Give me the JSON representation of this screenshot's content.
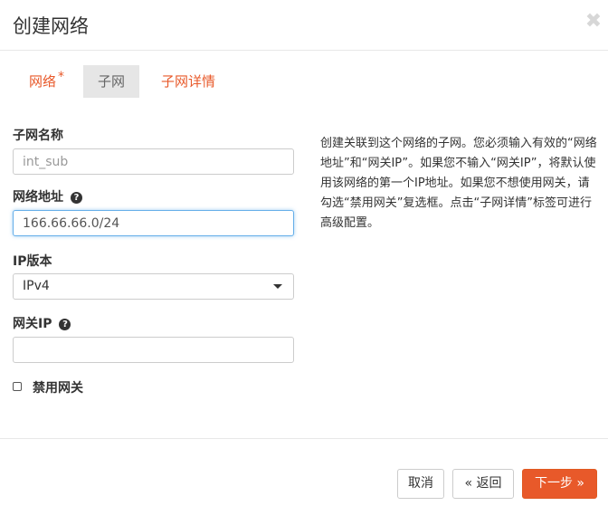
{
  "modal": {
    "title": "创建网络",
    "close_glyph": "✖"
  },
  "tabs": [
    {
      "label": "网络",
      "required_mark": "*"
    },
    {
      "label": "子网",
      "active": true
    },
    {
      "label": "子网详情"
    }
  ],
  "form": {
    "subnet_name": {
      "label": "子网名称",
      "placeholder": "int_sub",
      "value": ""
    },
    "network_address": {
      "label": "网络地址",
      "value": "166.66.66.0/24",
      "help_icon": "question-circle-icon"
    },
    "ip_version": {
      "label": "IP版本",
      "selected": "IPv4"
    },
    "gateway_ip": {
      "label": "网关IP",
      "value": "",
      "help_icon": "question-circle-icon"
    },
    "disable_gateway": {
      "label": "禁用网关",
      "checked": false
    }
  },
  "help_text": "创建关联到这个网络的子网。您必须输入有效的“网络地址”和“网关IP”。如果您不输入“网关IP”，将默认使用该网络的第一个IP地址。如果您不想使用网关，请勾选“禁用网关”复选框。点击“子网详情”标签可进行高级配置。",
  "footer": {
    "cancel_label": "取消",
    "back_label": "« 返回",
    "next_label": "下一步 »"
  },
  "colors": {
    "accent": "#e8592a",
    "focus": "#66afe9"
  }
}
